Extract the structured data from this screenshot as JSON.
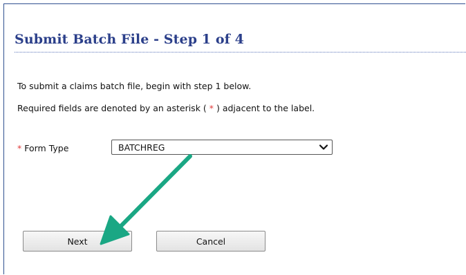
{
  "page": {
    "title": "Submit Batch File - Step 1 of 4",
    "intro_line_1": "To submit a claims batch file, begin with step 1 below.",
    "intro_line_2_prefix": "Required fields are denoted by an asterisk ( ",
    "intro_line_2_asterisk": "*",
    "intro_line_2_suffix": " ) adjacent to the label."
  },
  "form": {
    "form_type_required": "*",
    "form_type_label": "Form Type",
    "form_type_value": "BATCHREG"
  },
  "buttons": {
    "next_label": "Next",
    "cancel_label": "Cancel"
  },
  "colors": {
    "title": "#2b3f8a",
    "asterisk": "#e03a3a",
    "annotation_arrow": "#1aa784"
  },
  "icons": {
    "select_toggle": "chevron-down-icon",
    "annotation": "arrow-icon"
  }
}
